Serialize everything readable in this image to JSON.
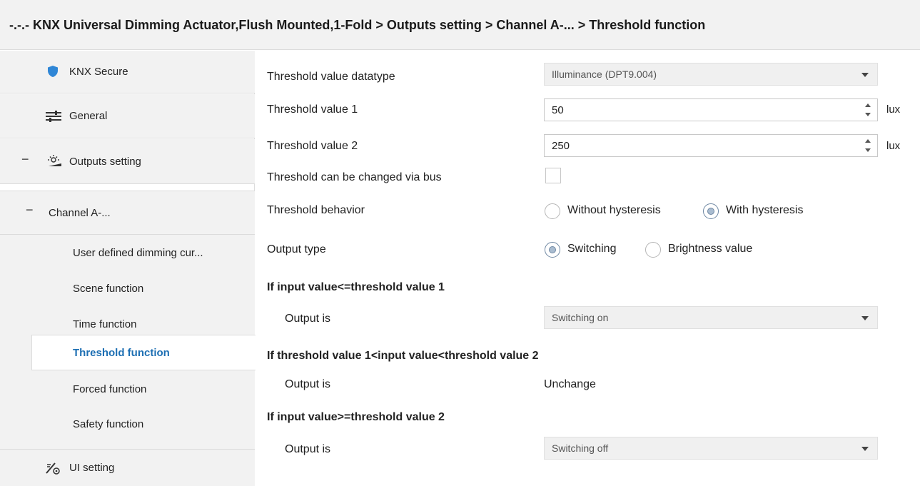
{
  "breadcrumb": "-.-.- KNX Universal Dimming Actuator,Flush Mounted,1-Fold > Outputs setting > Channel A-... > Threshold function",
  "sidebar": {
    "knx_secure": "KNX Secure",
    "general": "General",
    "outputs_setting": "Outputs setting",
    "channel": "Channel A-...",
    "toggle_minus": "−",
    "sub_items": [
      "User defined dimming cur...",
      "Scene function",
      "Time function",
      "Threshold function",
      "Forced function",
      "Safety function"
    ],
    "ui_setting": "UI setting"
  },
  "params": {
    "datatype_label": "Threshold value datatype",
    "datatype_value": "Illuminance (DPT9.004)",
    "t1_label": "Threshold value 1",
    "t1_value": "50",
    "t2_label": "Threshold value 2",
    "t2_value": "250",
    "unit": "lux",
    "bus_label": "Threshold can be changed via bus",
    "behavior_label": "Threshold behavior",
    "behavior_opt1": "Without hysteresis",
    "behavior_opt2": "With hysteresis",
    "output_type_label": "Output type",
    "output_type_opt1": "Switching",
    "output_type_opt2": "Brightness value",
    "section1": "If input value<=threshold value 1",
    "section2": "If  threshold value 1<input value<threshold value 2",
    "section3": "If input value>=threshold value 2",
    "output_is": "Output is",
    "out1_value": "Switching on",
    "out2_value": "Unchange",
    "out3_value": "Switching off"
  },
  "colors": {
    "accent": "#1d6fb3",
    "sidebar_bg": "#f2f2f2",
    "radio_fill": "#a9bcd0"
  }
}
